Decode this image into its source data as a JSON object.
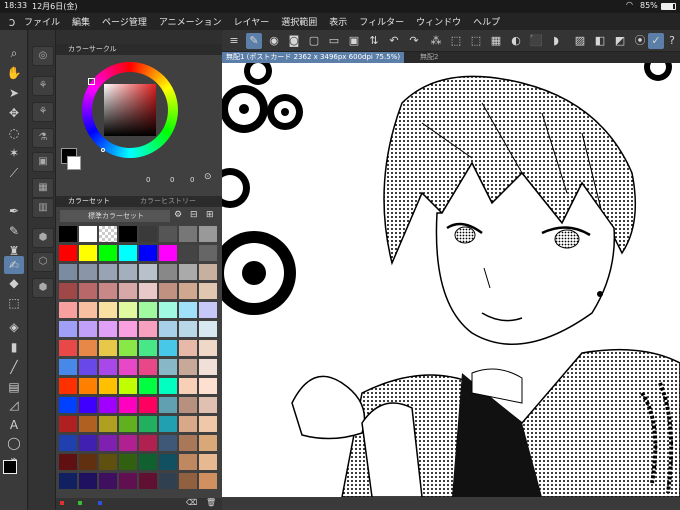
{
  "status": {
    "time": "18:33",
    "date": "12月6日(金)",
    "battery": "85%"
  },
  "menu": [
    "ファイル",
    "編集",
    "ページ管理",
    "アニメーション",
    "レイヤー",
    "選択範囲",
    "表示",
    "フィルター",
    "ウィンドウ",
    "ヘルプ"
  ],
  "panels": {
    "color_circle_title": "カラーサークル",
    "color_set_tab": "カラーセット",
    "color_history_tab": "カラーヒストリー",
    "color_set_name": "標準カラーセット",
    "hsv": {
      "h": "0",
      "s": "0",
      "v": "0"
    }
  },
  "tabs": {
    "active": "無配1 (ポストカード 2362 x 3496px 600dpi 75.5%)",
    "inactive": "無配2"
  },
  "colors": {
    "swatches": [
      [
        "#000000",
        "#ffffff",
        "checker",
        "#000000",
        "#3a3a3a",
        "#555555",
        "#777777",
        "#999999"
      ],
      [
        "#ff0000",
        "#ffff00",
        "#00ff00",
        "#00ffff",
        "#0000ff",
        "#ff00ff",
        "#444444",
        "#666666"
      ],
      [
        "#7b8ba0",
        "#8a96a8",
        "#98a3b3",
        "#a4afbd",
        "#b8c0cc",
        "#888888",
        "#aaaaaa",
        "#c8b0a0"
      ],
      [
        "#a04848",
        "#b86868",
        "#c88888",
        "#d8a8a8",
        "#e8c8c8",
        "#c09080",
        "#d0a890",
        "#e0c8b0"
      ],
      [
        "#f8a0a0",
        "#f8c0a0",
        "#f8e0a0",
        "#e0f8a0",
        "#a0f8a0",
        "#a0f8e0",
        "#a0e0f8",
        "#c8c8f8"
      ],
      [
        "#a0a0f8",
        "#c0a0f8",
        "#e0a0f8",
        "#f8a0e0",
        "#f8a0c0",
        "#a8d0e8",
        "#b8d8e8",
        "#d8e8f0"
      ],
      [
        "#e84848",
        "#e88848",
        "#e8c848",
        "#88e848",
        "#48e888",
        "#48c8e8",
        "#e8b8a8",
        "#f0d8c8"
      ],
      [
        "#4888e8",
        "#6848e8",
        "#a848e8",
        "#e848c8",
        "#e84888",
        "#88b8c8",
        "#c8a898",
        "#f0e0d8"
      ],
      [
        "#ff3000",
        "#ff8000",
        "#ffc000",
        "#c0ff00",
        "#00ff40",
        "#00ffc0",
        "#f8d0b8",
        "#fde0d0"
      ],
      [
        "#0040ff",
        "#4000ff",
        "#a000ff",
        "#ff00c0",
        "#ff0060",
        "#60a0b0",
        "#b89080",
        "#e0c0b0"
      ],
      [
        "#b02020",
        "#b06020",
        "#b0a020",
        "#60b020",
        "#20b060",
        "#20a0b0",
        "#d8a888",
        "#f0c8a8"
      ],
      [
        "#2040b0",
        "#4020b0",
        "#8020b0",
        "#b02090",
        "#b02050",
        "#405878",
        "#a87858",
        "#d8a878"
      ],
      [
        "#601010",
        "#603010",
        "#605010",
        "#306010",
        "#106030",
        "#105060",
        "#c08860",
        "#e8b890"
      ],
      [
        "#102060",
        "#201060",
        "#401060",
        "#601050",
        "#601030",
        "#304050",
        "#906040",
        "#d09060"
      ]
    ]
  }
}
